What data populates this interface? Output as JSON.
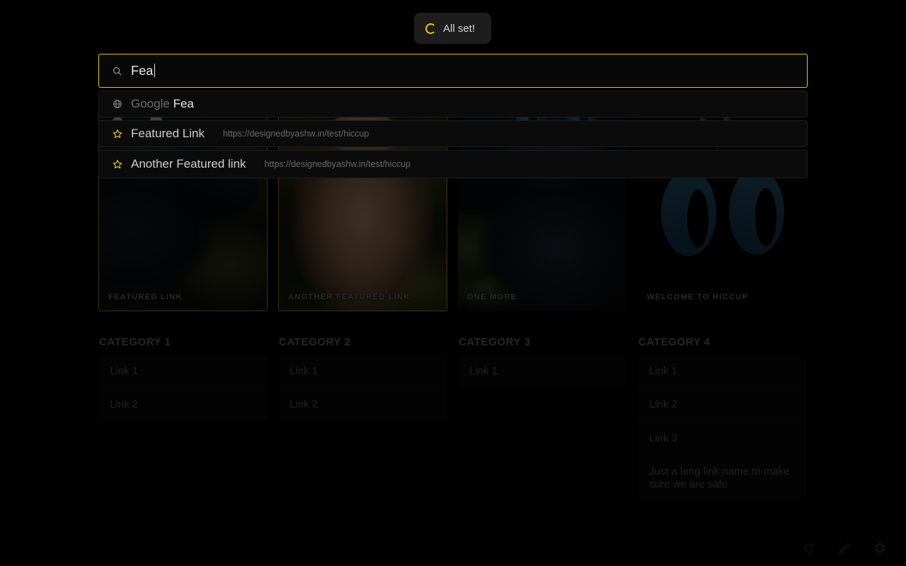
{
  "toast": {
    "icon": "spinner-icon",
    "message": "All set!"
  },
  "search": {
    "icon": "search-icon",
    "value": "Fea",
    "suggestions": [
      {
        "icon": "globe-icon",
        "prefix": "Google",
        "query": "Fea",
        "url": ""
      },
      {
        "icon": "star-icon",
        "title": "Featured Link",
        "url": "https://designedbyashw.in/test/hiccup"
      },
      {
        "icon": "star-icon",
        "title": "Another Featured link",
        "url": "https://designedbyashw.in/test/hiccup"
      }
    ]
  },
  "featured": [
    {
      "label": "FEATURED LINK",
      "selected": true
    },
    {
      "label": "ANOTHER FEATURED LINK",
      "selected": true
    },
    {
      "label": "ONE MORE",
      "selected": false
    },
    {
      "label": "WELCOME TO HICCUP",
      "selected": false
    }
  ],
  "categories": [
    {
      "title": "CATEGORY 1",
      "links": [
        "Link 1",
        "Link 2"
      ]
    },
    {
      "title": "CATEGORY 2",
      "links": [
        "Link 1",
        "Link 2"
      ]
    },
    {
      "title": "CATEGORY 3",
      "links": [
        "Link 1"
      ]
    },
    {
      "title": "CATEGORY 4",
      "links": [
        "Link 1",
        "Link 2",
        "Link 3",
        "Just a long link name to make sure we are safe"
      ]
    }
  ],
  "toolbar": [
    {
      "icon": "refresh-icon",
      "name": "refresh-button"
    },
    {
      "icon": "pencil-icon",
      "name": "edit-button"
    },
    {
      "icon": "gear-icon",
      "name": "settings-button"
    }
  ],
  "colors": {
    "accent": "#e8c324",
    "background": "#000000",
    "card": "#0a0a0a",
    "toast_bg": "#1d1d1d",
    "muted_text": "#6b6b6b"
  }
}
